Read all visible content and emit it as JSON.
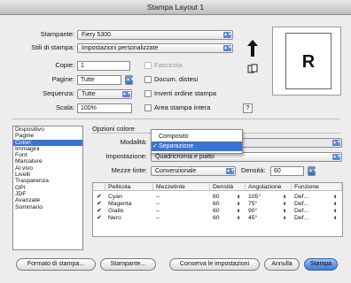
{
  "window": {
    "title": "Stampa Layout 1"
  },
  "top": {
    "stampante_label": "Stampante:",
    "stampante_value": "Fiery 5300",
    "stili_label": "Stili di stampa:",
    "stili_value": "Impostazioni personalizzate",
    "copie_label": "Copie:",
    "copie_value": "1",
    "pagine_label": "Pagine:",
    "pagine_value": "Tutte",
    "sequenza_label": "Sequenza:",
    "sequenza_value": "Tutte",
    "scala_label": "Scala:",
    "scala_value": "100%",
    "fascicola_label": "Fascicola",
    "docum_distesi_label": "Docum. distesi",
    "inverti_label": "Inverti ordine stampa",
    "area_label": "Area stampa intera",
    "help_label": "?",
    "preview_letter": "R"
  },
  "sidebar": {
    "items": [
      "Dispositivo",
      "Pagine",
      "Colori",
      "Immagini",
      "Font",
      "Marcature",
      "Al vivo",
      "Livelli",
      "Trasparenza",
      "OPI",
      "JDF",
      "Avanzate",
      "Sommario"
    ],
    "selected_index": 2
  },
  "panel": {
    "opzioni_label": "Opzioni colore",
    "modalita_label": "Modalità:",
    "impostazione_label": "Impostazione:",
    "impostazione_value": "Quadricromia e piatto",
    "mezze_tinte_label": "Mezze tinte:",
    "mezze_tinte_value": "Convenzionale",
    "densita_label": "Densità:",
    "densita_value": "60"
  },
  "menu": {
    "items": [
      "Composito",
      "Separazione"
    ],
    "selected": "Separazione",
    "check": "✓"
  },
  "table": {
    "headers": [
      "Pellicola",
      "Mezzetinte",
      "Densità",
      "Angolazione",
      "Funzione"
    ],
    "rows": [
      {
        "name": "Cyan",
        "mezz": "–",
        "dens": "60",
        "ang": "105°",
        "fun": "Def..."
      },
      {
        "name": "Magenta",
        "mezz": "–",
        "dens": "60",
        "ang": "75°",
        "fun": "Def..."
      },
      {
        "name": "Giallo",
        "mezz": "–",
        "dens": "60",
        "ang": "90°",
        "fun": "Def..."
      },
      {
        "name": "Nero",
        "mezz": "–",
        "dens": "60",
        "ang": "45°",
        "fun": "Def..."
      }
    ]
  },
  "buttons": {
    "formato": "Formato di stampa...",
    "stampante": "Stampante...",
    "conserva": "Conserva le impostazioni",
    "annulla": "Annulla",
    "stampa": "Stampa"
  },
  "colors": {
    "accent": "#3b73d2",
    "default_button": "#3d7ad8"
  }
}
